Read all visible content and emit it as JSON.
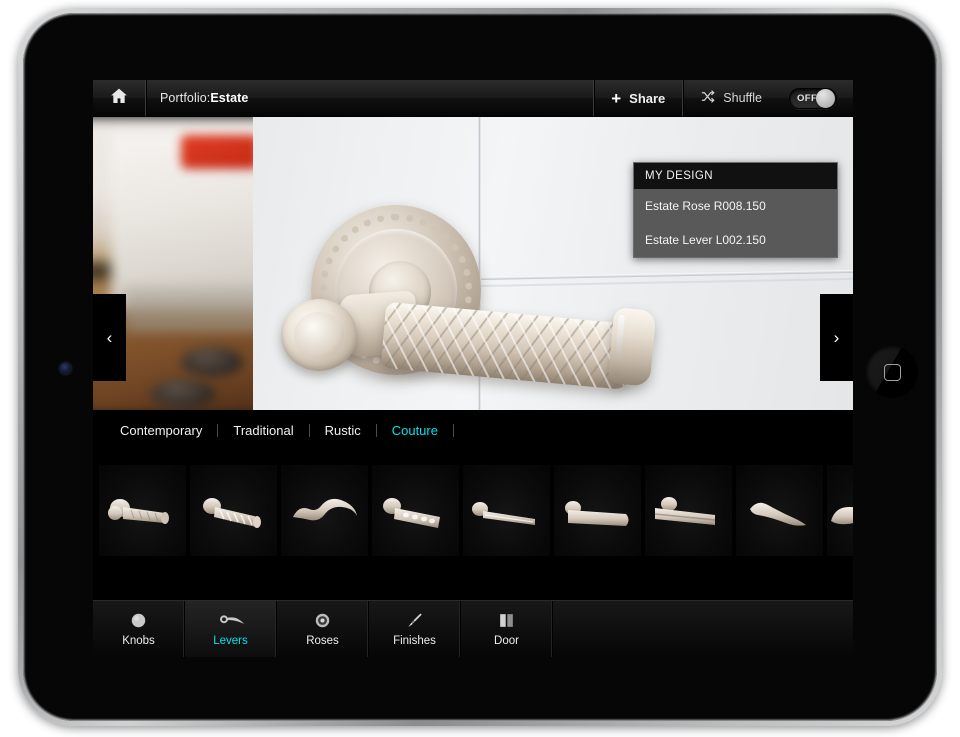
{
  "app": {
    "device": "ipad-landscape"
  },
  "toolbar": {
    "home_icon": "home-icon",
    "portfolio_prefix": "Portfolio: ",
    "portfolio_name": "Estate",
    "share_label": "Share",
    "share_icon": "plus-icon",
    "shuffle_label": "Shuffle",
    "shuffle_icon": "shuffle-icon",
    "toggle_state": "OFF"
  },
  "viewer": {
    "prev_arrow": "‹",
    "next_arrow": "›",
    "hero_alt": "Satin nickel lever handle with beaded rose on white door",
    "my_design": {
      "title": "MY DESIGN",
      "items": [
        {
          "label": "Estate Rose R008.150"
        },
        {
          "label": "Estate Lever L002.150"
        }
      ]
    }
  },
  "categories": {
    "tabs": [
      {
        "label": "Contemporary",
        "active": false
      },
      {
        "label": "Traditional",
        "active": false
      },
      {
        "label": "Rustic",
        "active": false
      },
      {
        "label": "Couture",
        "active": true
      }
    ],
    "active_color": "#00e2ee"
  },
  "thumbnails": {
    "items": [
      {
        "name": "lever-thumb-1",
        "style": "knurled-barrel-lever"
      },
      {
        "name": "lever-thumb-2",
        "style": "spiral-twist-lever"
      },
      {
        "name": "lever-thumb-3",
        "style": "wave-scroll-lever"
      },
      {
        "name": "lever-thumb-4",
        "style": "pierced-barrel-lever"
      },
      {
        "name": "lever-thumb-5",
        "style": "slim-straight-lever"
      },
      {
        "name": "lever-thumb-6",
        "style": "tapered-smooth-lever"
      },
      {
        "name": "lever-thumb-7",
        "style": "flat-bar-lever"
      },
      {
        "name": "lever-thumb-8",
        "style": "curved-wing-lever"
      },
      {
        "name": "lever-thumb-9",
        "style": "partial-lever"
      }
    ]
  },
  "bottom_nav": {
    "items": [
      {
        "label": "Knobs",
        "icon": "knob-icon",
        "active": false
      },
      {
        "label": "Levers",
        "icon": "lever-icon",
        "active": true
      },
      {
        "label": "Roses",
        "icon": "rose-icon",
        "active": false
      },
      {
        "label": "Finishes",
        "icon": "paintbrush-icon",
        "active": false
      },
      {
        "label": "Door",
        "icon": "door-icon",
        "active": false
      }
    ]
  }
}
